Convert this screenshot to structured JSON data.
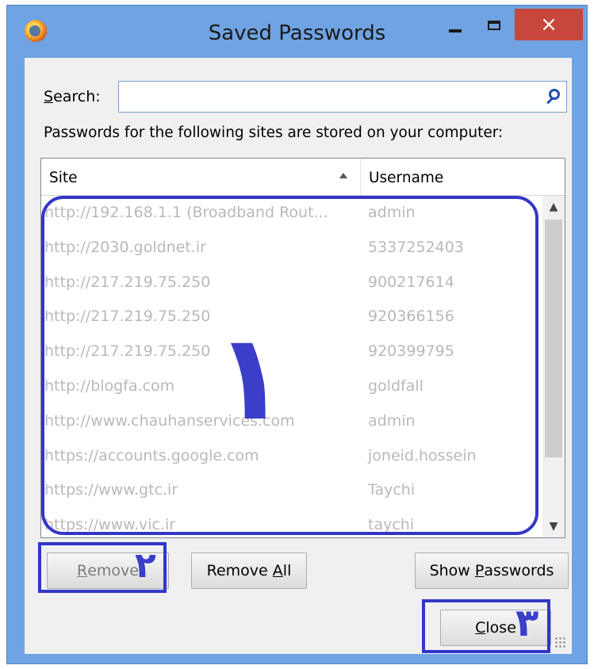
{
  "window": {
    "title": "Saved Passwords",
    "app_icon": "firefox-icon",
    "controls": {
      "minimize": "minimize-icon",
      "maximize": "maximize-icon",
      "close": "×"
    },
    "accent": "#6fa3e2",
    "close_color": "#c9463d"
  },
  "search": {
    "label_prefix": "S",
    "label_rest": "earch:",
    "value": "",
    "icon": "search-icon"
  },
  "info_text": "Passwords for the following sites are stored on your computer:",
  "table": {
    "columns": {
      "site": "Site",
      "username": "Username"
    },
    "sort_indicator": "ascending",
    "rows": [
      {
        "site": "http://192.168.1.1 (Broadband Rout...",
        "username": "admin"
      },
      {
        "site": "http://2030.goldnet.ir",
        "username": "5337252403"
      },
      {
        "site": "http://217.219.75.250",
        "username": "900217614"
      },
      {
        "site": "http://217.219.75.250",
        "username": "920366156"
      },
      {
        "site": "http://217.219.75.250",
        "username": "920399795"
      },
      {
        "site": "http://blogfa.com",
        "username": "goldfall"
      },
      {
        "site": "http://www.chauhanservices.com",
        "username": "admin"
      },
      {
        "site": "https://accounts.google.com",
        "username": "joneid.hossein"
      },
      {
        "site": "https://www.gtc.ir",
        "username": "Taychi"
      },
      {
        "site": "https://www.vic.ir",
        "username": "taychi"
      }
    ]
  },
  "buttons": {
    "remove_prefix": "R",
    "remove_rest": "emove",
    "remove_all_prefix": "Remove ",
    "remove_all_key": "A",
    "remove_all_rest": "ll",
    "show_prefix": "Show ",
    "show_key": "P",
    "show_rest": "asswords",
    "close_key": "C",
    "close_rest": "lose"
  },
  "annotations": {
    "marker_1": "١",
    "marker_2": "٢",
    "marker_3": "٣",
    "color": "#3236c8"
  }
}
